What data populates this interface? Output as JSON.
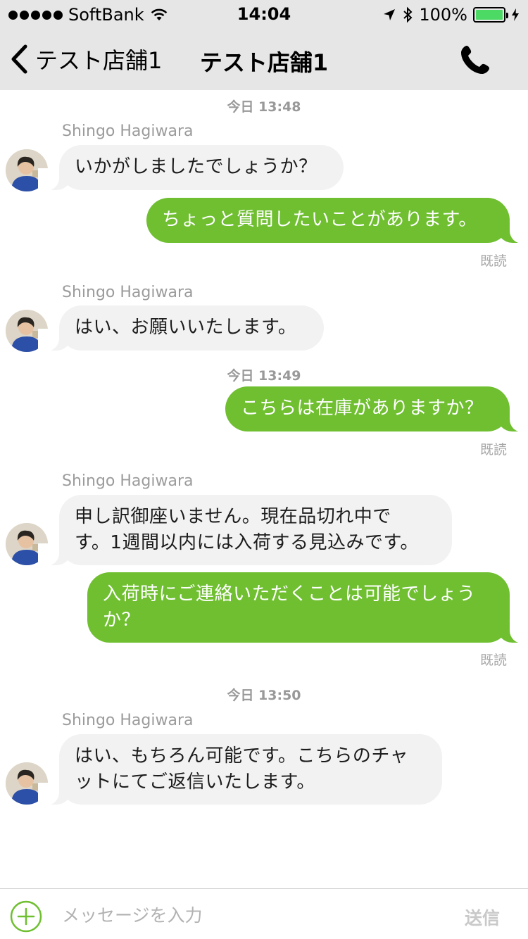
{
  "status_bar": {
    "carrier": "SoftBank",
    "time": "14:04",
    "battery": "100%",
    "battery_level": 1.0
  },
  "nav": {
    "back_label": "テスト店舗1",
    "title": "テスト店舗1"
  },
  "chat": {
    "timestamps": [
      "今日 13:48",
      "今日 13:49",
      "今日 13:50"
    ],
    "sender_name": "Shingo Hagiwara",
    "read_label": "既読",
    "messages": [
      {
        "from": "in",
        "text": "いかがしましたでしょうか？"
      },
      {
        "from": "out",
        "text": "ちょっと質問したいことがあります。"
      },
      {
        "from": "in",
        "text": "はい、お願いいたします。"
      },
      {
        "from": "out",
        "text": "こちらは在庫がありますか？"
      },
      {
        "from": "in",
        "lines": [
          "申し訳御座いません。現在品切れ中で",
          "す。1週間以内には入荷する見込みです。"
        ]
      },
      {
        "from": "out",
        "lines": [
          "入荷時にご連絡いただくことは可能でしょう",
          "か？"
        ]
      },
      {
        "from": "in",
        "lines": [
          "はい、もちろん可能です。こちらのチャ",
          "ットにてご返信いたします。"
        ]
      }
    ]
  },
  "input_bar": {
    "placeholder": "メッセージを入力",
    "send_label": "送信"
  },
  "colors": {
    "nav_background": "#e6e6e6",
    "outgoing_bubble": "#6fbf31",
    "incoming_bubble": "#f2f2f2",
    "accent_green": "#6fbf31"
  }
}
